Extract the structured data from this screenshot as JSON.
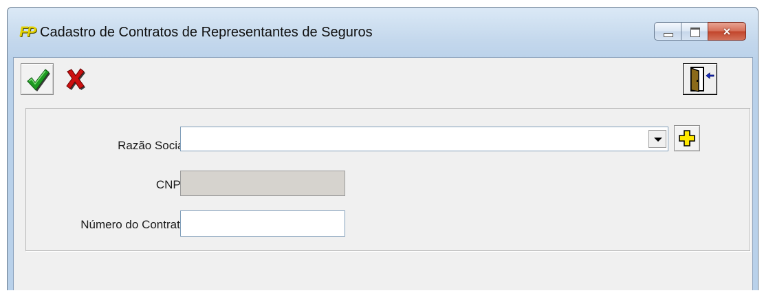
{
  "window": {
    "title": "Cadastro de Contratos de Representantes de Seguros",
    "app_icon_text": "FP",
    "controls": {
      "minimize": "minimize",
      "maximize": "maximize",
      "close": "×"
    }
  },
  "toolbar": {
    "confirm_icon": "checkmark-icon",
    "cancel_icon": "x-icon",
    "exit_icon": "exit-door-icon"
  },
  "form": {
    "razao_social": {
      "label": "Razão Social:",
      "value": ""
    },
    "cnpj": {
      "label": "CNPJ:",
      "value": ""
    },
    "numero_contrato": {
      "label": "Número do Contrato:",
      "value": ""
    }
  },
  "colors": {
    "confirm_green": "#1e8a1e",
    "cancel_red": "#c00000",
    "add_yellow": "#ffe800"
  }
}
